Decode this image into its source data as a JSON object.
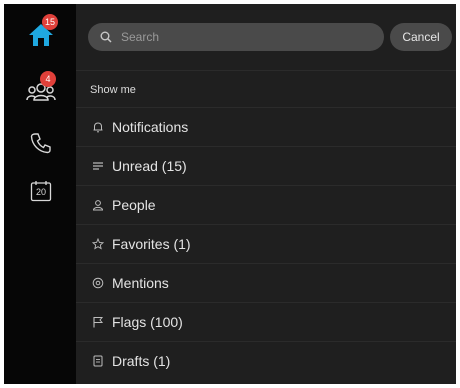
{
  "colors": {
    "rail_bg": "#060606",
    "panel_bg": "#1f1f1f",
    "pill_bg": "#4a4a4a",
    "badge": "#e0403a",
    "home_accent": "#1fa8e0"
  },
  "rail": {
    "items": [
      {
        "icon": "home-icon",
        "badge": "15"
      },
      {
        "icon": "people-icon",
        "badge": "4"
      },
      {
        "icon": "phone-icon",
        "badge": ""
      },
      {
        "icon": "calendar-icon",
        "day": "20"
      }
    ]
  },
  "search": {
    "placeholder": "Search",
    "value": ""
  },
  "cancel_label": "Cancel",
  "show_me_label": "Show me",
  "filters": [
    {
      "label": "Notifications",
      "icon": "bell-icon"
    },
    {
      "label": "Unread (15)",
      "icon": "unread-lines-icon"
    },
    {
      "label": "People",
      "icon": "person-icon"
    },
    {
      "label": "Favorites (1)",
      "icon": "star-icon"
    },
    {
      "label": "Mentions",
      "icon": "at-icon"
    },
    {
      "label": "Flags (100)",
      "icon": "flag-icon"
    },
    {
      "label": "Drafts (1)",
      "icon": "draft-icon"
    }
  ]
}
